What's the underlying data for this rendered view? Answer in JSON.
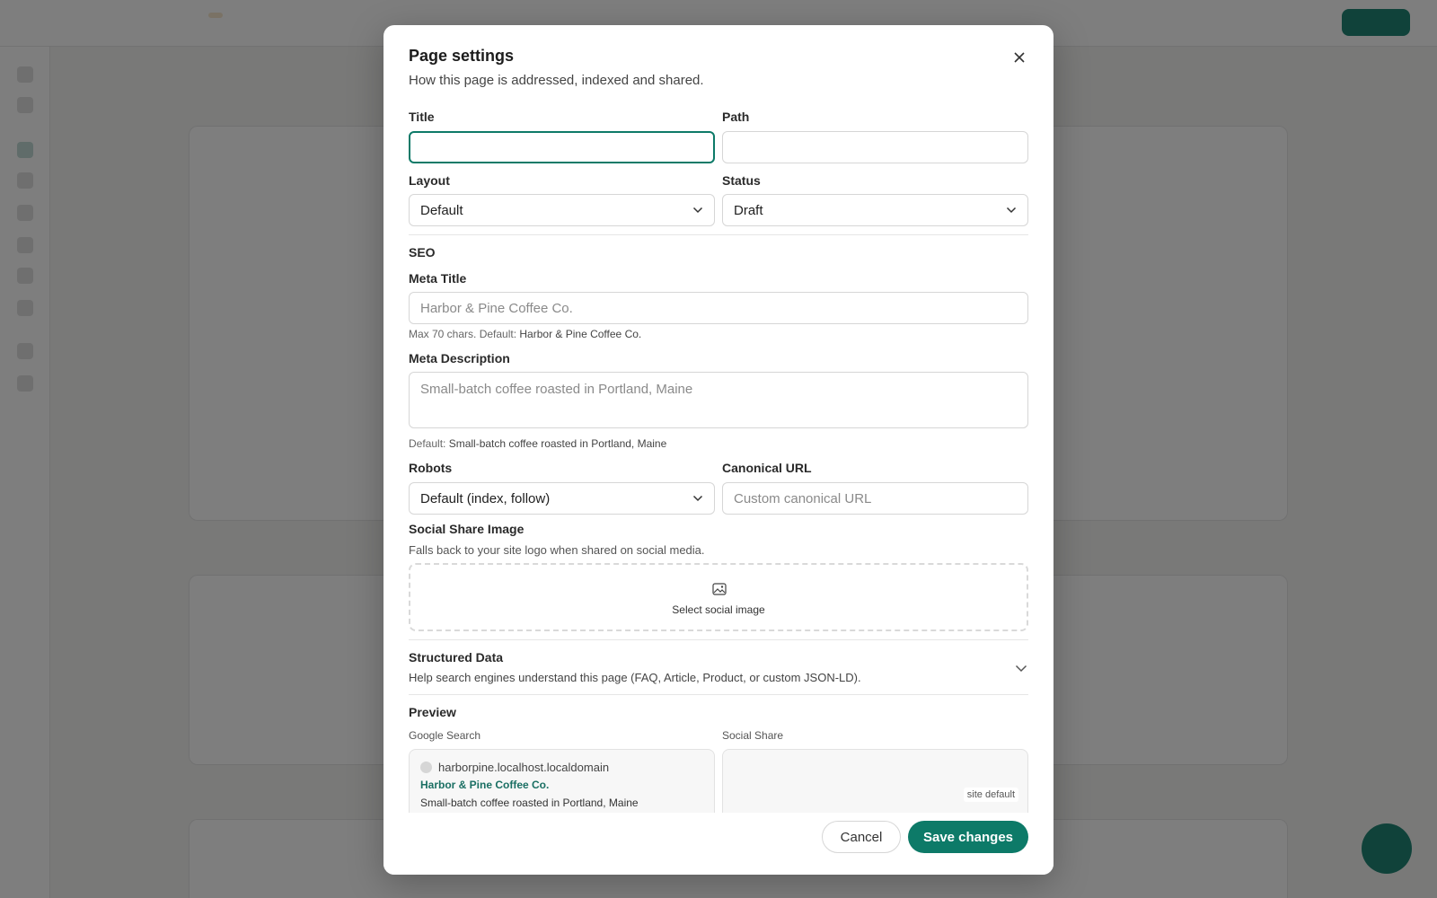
{
  "modal": {
    "title": "Page settings",
    "subtitle": "How this page is addressed, indexed and shared.",
    "close_icon": "close-icon"
  },
  "fields": {
    "title": {
      "label": "Title",
      "value": ""
    },
    "path": {
      "label": "Path",
      "value": ""
    },
    "layout": {
      "label": "Layout",
      "value": "Default"
    },
    "status": {
      "label": "Status",
      "value": "Draft"
    }
  },
  "seo": {
    "section_title": "SEO",
    "meta_title": {
      "label": "Meta Title",
      "placeholder": "Harbor & Pine Coffee Co.",
      "hint_prefix": "Max 70 chars. Default: ",
      "hint_default": "Harbor & Pine Coffee Co."
    },
    "meta_description": {
      "label": "Meta Description",
      "placeholder": "Small-batch coffee roasted in Portland, Maine",
      "hint_prefix": "Default: ",
      "hint_default": "Small-batch coffee roasted in Portland, Maine"
    },
    "robots": {
      "label": "Robots",
      "value": "Default (index, follow)"
    },
    "canonical": {
      "label": "Canonical URL",
      "placeholder": "Custom canonical URL"
    },
    "social_image": {
      "label": "Social Share Image",
      "hint": "Falls back to your site logo when shared on social media.",
      "button": "Select social image"
    }
  },
  "structured_data": {
    "title": "Structured Data",
    "subtitle": "Help search engines understand this page (FAQ, Article, Product, or custom JSON-LD)."
  },
  "preview": {
    "title": "Preview",
    "google": {
      "label": "Google Search",
      "domain": "harborpine.localhost.localdomain",
      "title": "Harbor & Pine Coffee Co.",
      "description": "Small-batch coffee roasted in Portland, Maine"
    },
    "social": {
      "label": "Social Share",
      "badge": "site default"
    }
  },
  "footer": {
    "cancel": "Cancel",
    "save": "Save changes"
  },
  "colors": {
    "accent": "#0d7a68",
    "link": "#1a6f63"
  }
}
